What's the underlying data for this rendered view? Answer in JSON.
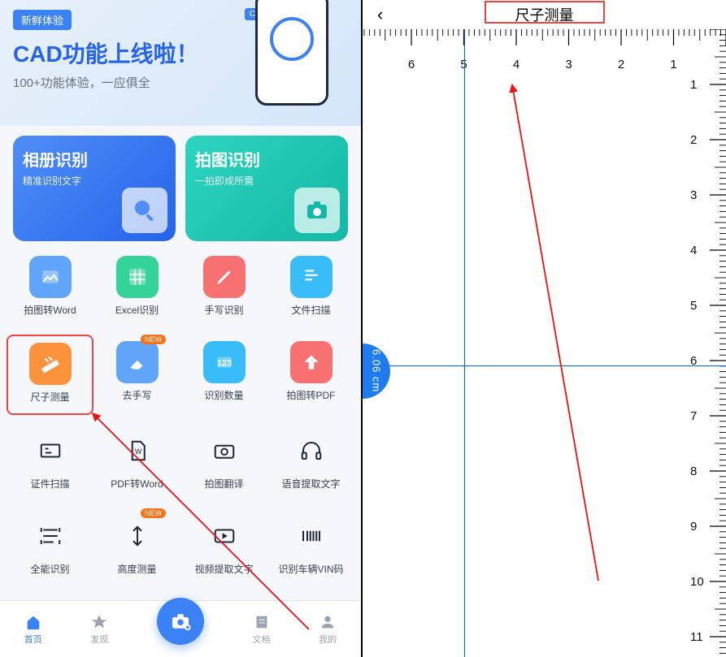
{
  "banner": {
    "tag": "新鲜体验",
    "title": "CAD功能上线啦！",
    "subtitle": "100+功能体验，一应俱全",
    "cad_label": "CAD"
  },
  "big_cards": [
    {
      "title": "相册识别",
      "subtitle": "精准识别文字"
    },
    {
      "title": "拍图识别",
      "subtitle": "一拍即成所需"
    }
  ],
  "tools_row1": [
    {
      "label": "拍图转Word"
    },
    {
      "label": "Excel识别"
    },
    {
      "label": "手写识别"
    },
    {
      "label": "文件扫描"
    }
  ],
  "tools_row2": [
    {
      "label": "尺子测量"
    },
    {
      "label": "去手写",
      "new": "NEW"
    },
    {
      "label": "识别数量"
    },
    {
      "label": "拍图转PDF"
    }
  ],
  "tools_row3": [
    {
      "label": "证件扫描"
    },
    {
      "label": "PDF转Word"
    },
    {
      "label": "拍图翻译"
    },
    {
      "label": "语音提取文字"
    }
  ],
  "tools_row4": [
    {
      "label": "全能识别"
    },
    {
      "label": "高度测量",
      "new": "NEW"
    },
    {
      "label": "视频提取文字"
    },
    {
      "label": "识别车辆VIN码"
    }
  ],
  "nav": {
    "home": "首页",
    "discover": "发现",
    "docs": "文档",
    "mine": "我的"
  },
  "ruler_page": {
    "title": "尺子测量",
    "measurement": "6.06 cm",
    "top_numbers": [
      "6",
      "5",
      "4",
      "3",
      "2",
      "1"
    ],
    "right_numbers": [
      "1",
      "2",
      "3",
      "4",
      "5",
      "6",
      "7",
      "8",
      "9",
      "10",
      "11"
    ]
  }
}
